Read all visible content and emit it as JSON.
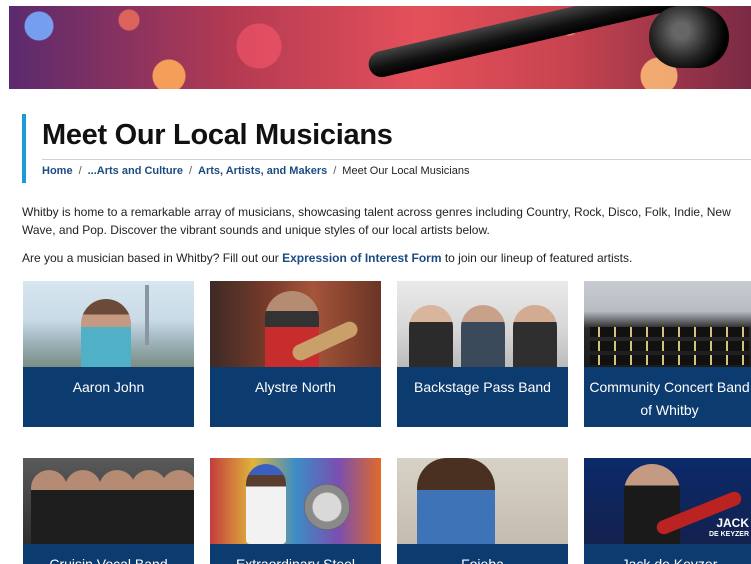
{
  "page": {
    "title": "Meet Our Local Musicians"
  },
  "breadcrumb": {
    "items": [
      "Home",
      "...Arts and Culture",
      "Arts, Artists, and Makers"
    ],
    "current": "Meet Our Local Musicians",
    "separator": "/"
  },
  "intro": {
    "text": "Whitby is home to a remarkable array of musicians, showcasing talent across genres including Country, Rock, Disco, Folk, Indie, New Wave, and Pop. Discover the vibrant sounds and unique styles of our local artists below."
  },
  "cta": {
    "before": "Are you a musician based in Whitby? Fill out our ",
    "link": "Expression of Interest Form",
    "after": " to join our lineup of featured artists."
  },
  "musicians": [
    {
      "name": "Aaron John"
    },
    {
      "name": "Alystre North"
    },
    {
      "name": "Backstage Pass Band"
    },
    {
      "name": "Community Concert Band of Whitby"
    },
    {
      "name": "Cruisin Vocal Band"
    },
    {
      "name": "Extraordinary Steel"
    },
    {
      "name": "Fojeba"
    },
    {
      "name": "Jack de Keyzer"
    }
  ],
  "photo_text": {
    "jack_brand_line1": "JACK",
    "jack_brand_line2": "DE KEYZER"
  },
  "colors": {
    "accent": "#1a9ad6",
    "link": "#1c4b82",
    "card_label_bg": "#0c3b6f"
  }
}
